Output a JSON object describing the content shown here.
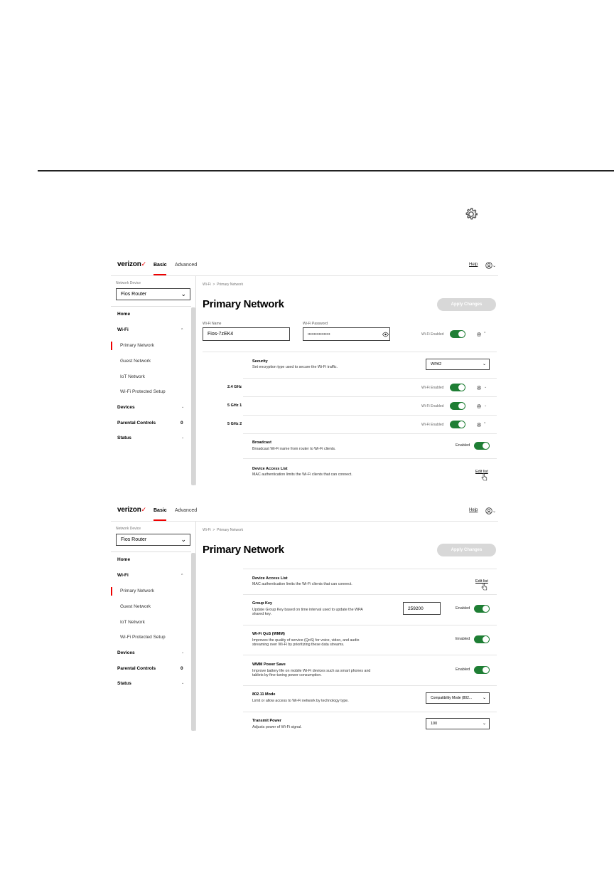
{
  "app": {
    "logo": "verizon",
    "logo_check": "✓",
    "tabs": {
      "basic": "Basic",
      "advanced": "Advanced"
    },
    "help": "Help"
  },
  "sidebar": {
    "network_device_label": "Network Device",
    "network_device_value": "Fios Router",
    "items": {
      "home": "Home",
      "wifi": "Wi-Fi",
      "primary_network": "Primary Network",
      "guest_network": "Guest Network",
      "iot_network": "IoT Network",
      "wps": "Wi-Fi Protected Setup",
      "devices": "Devices",
      "parental_controls": "Parental Controls",
      "parental_count": "0",
      "status": "Status"
    }
  },
  "breadcrumb": {
    "root": "Wi-Fi",
    "sep": ">",
    "current": "Primary Network"
  },
  "page_title": "Primary Network",
  "apply_button": "Apply Changes",
  "screen1": {
    "wifi_name_label": "Wi-Fi Name",
    "wifi_name_value": "Fios-7zEK4",
    "wifi_password_label": "Wi-Fi Password",
    "wifi_password_value": "••••••••••••••••••",
    "wifi_enabled_label": "Wi-Fi Enabled",
    "security_title": "Security",
    "security_desc": "Set encryption type used to secure the Wi-Fi traffic.",
    "security_value": "WPA2",
    "band_24": "2.4 GHz",
    "band_5_1": "5 GHz 1",
    "band_5_2": "5 GHz 2",
    "band_enabled_label": "Wi-Fi Enabled",
    "broadcast_title": "Broadcast",
    "broadcast_desc": "Broadcast Wi-Fi name from router to Wi-Fi clients.",
    "enabled_label": "Enabled",
    "dal_title": "Device Access List",
    "dal_desc": "MAC authentication limits the Wi-Fi clients that can connect.",
    "edit_list": "Edit list"
  },
  "screen2": {
    "dal_title": "Device Access List",
    "dal_desc": "MAC authentication limits the Wi-Fi clients that can connect.",
    "edit_list": "Edit list",
    "group_key_title": "Group Key",
    "group_key_desc_1": "Update Group Key based on time interval used to update the WPA",
    "group_key_desc_2": "shared key.",
    "group_key_value": "259200",
    "enabled_label": "Enabled",
    "wmm_title": "Wi-Fi QoS (WMM)",
    "wmm_desc_1": "Improves the quality of service (QoS) for voice, video, and audio",
    "wmm_desc_2": "streaming over Wi-Fi by prioritizing these data streams.",
    "wmm_ps_title": "WMM Power Save",
    "wmm_ps_desc_1": "Improve battery life on mobile Wi-Fi devices such as smart phones and",
    "wmm_ps_desc_2": "tablets by fine-tuning power consumption.",
    "mode_title": "802.11 Mode",
    "mode_desc": "Limit or allow access to Wi-Fi network by technology type.",
    "mode_value": "Compatibility Mode (802...",
    "tx_title": "Transmit Power",
    "tx_desc": "Adjusts power of Wi-Fi signal.",
    "tx_value": "100"
  },
  "colors": {
    "accent": "#e00000",
    "toggle_on": "#1e7e34",
    "button_disabled": "#d8d8d8"
  },
  "icons": [
    "gear-icon",
    "user-icon",
    "eye-icon",
    "chevron-down-icon",
    "chevron-up-icon",
    "hand-cursor-icon"
  ]
}
